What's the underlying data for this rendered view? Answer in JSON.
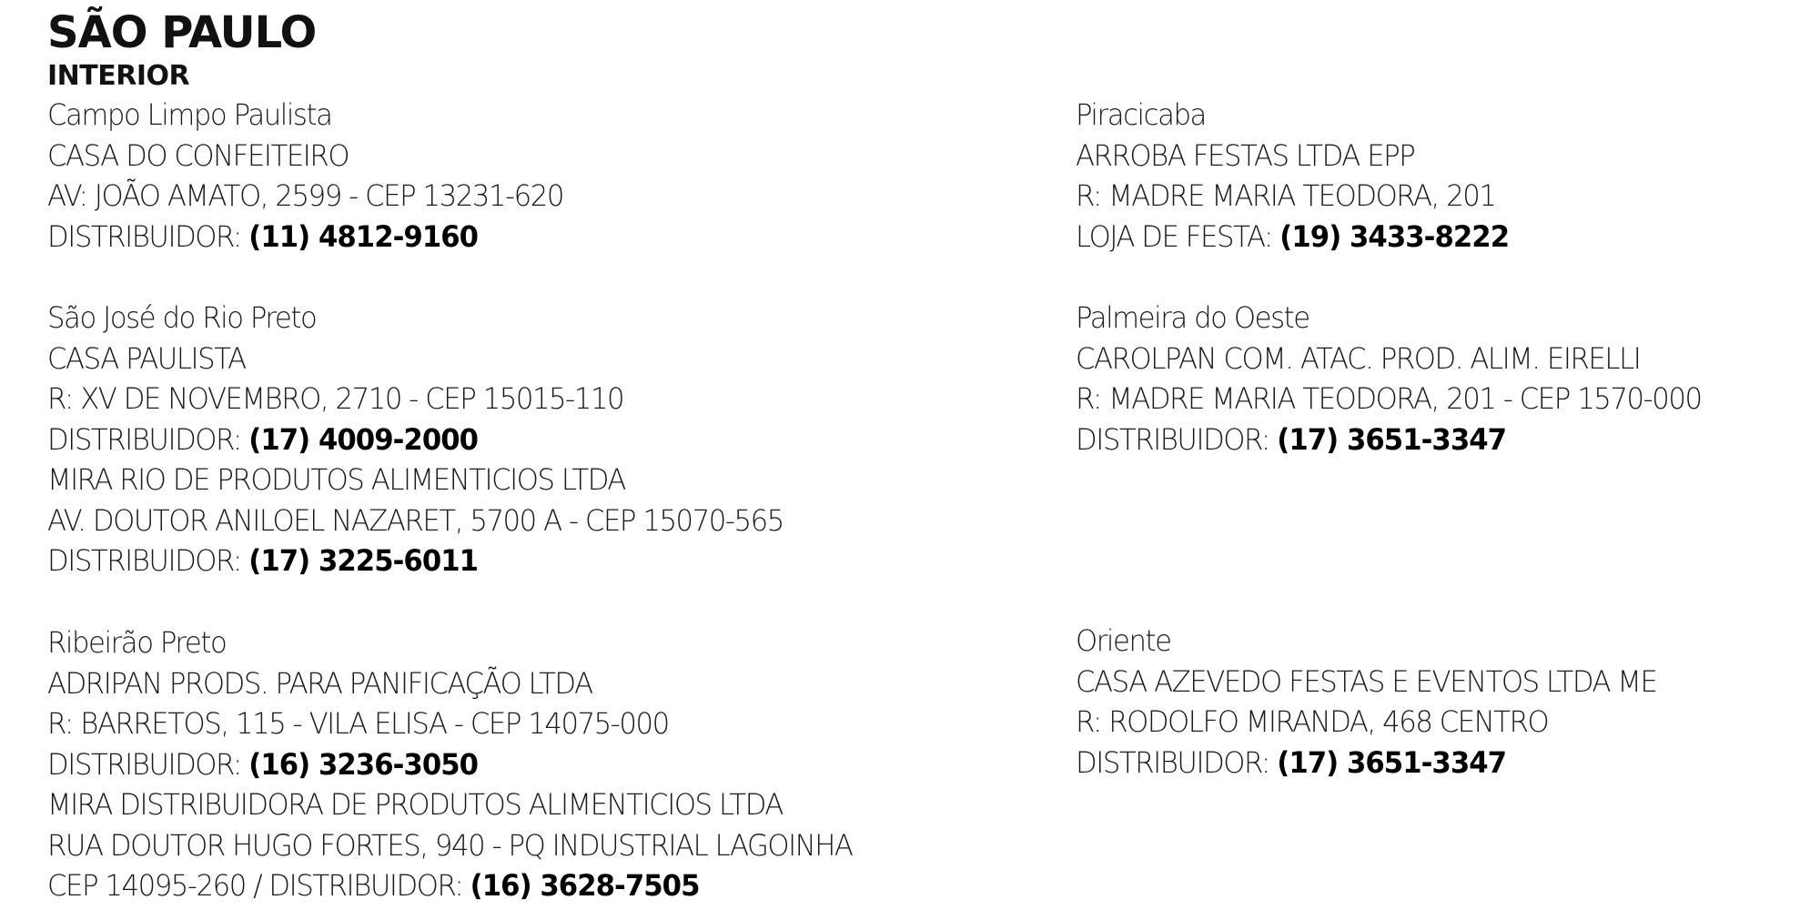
{
  "header": {
    "title": "SÃO PAULO",
    "subtitle": "INTERIOR"
  },
  "left_column": [
    {
      "city": "Campo Limpo Paulista",
      "lines": [
        {
          "text": "CASA DO CONFEITEIRO",
          "phone": ""
        },
        {
          "text": "AV: JOÃO AMATO, 2599 - CEP 13231-620",
          "phone": ""
        },
        {
          "text": "DISTRIBUIDOR: ",
          "phone": "(11) 4812-9160"
        }
      ]
    },
    {
      "city": "São José do Rio Preto",
      "lines": [
        {
          "text": "CASA PAULISTA",
          "phone": ""
        },
        {
          "text": "R: XV DE NOVEMBRO, 2710 - CEP 15015-110",
          "phone": ""
        },
        {
          "text": "DISTRIBUIDOR: ",
          "phone": "(17) 4009-2000"
        },
        {
          "text": "MIRA RIO DE PRODUTOS ALIMENTICIOS LTDA",
          "phone": ""
        },
        {
          "text": "AV. DOUTOR ANILOEL NAZARET, 5700 A - CEP 15070-565",
          "phone": ""
        },
        {
          "text": "DISTRIBUIDOR: ",
          "phone": "(17) 3225-6011"
        }
      ]
    },
    {
      "city": "Ribeirão Preto",
      "lines": [
        {
          "text": "ADRIPAN PRODS. PARA PANIFICAÇÃO LTDA",
          "phone": ""
        },
        {
          "text": "R: BARRETOS, 115 - VILA ELISA - CEP 14075-000",
          "phone": ""
        },
        {
          "text": "DISTRIBUIDOR: ",
          "phone": "(16) 3236-3050"
        },
        {
          "text": "MIRA DISTRIBUIDORA DE PRODUTOS ALIMENTICIOS LTDA",
          "phone": ""
        },
        {
          "text": "RUA DOUTOR HUGO FORTES, 940 - PQ INDUSTRIAL LAGOINHA",
          "phone": ""
        },
        {
          "text": "CEP 14095-260 / DISTRIBUIDOR: ",
          "phone": "(16) 3628-7505"
        }
      ]
    }
  ],
  "right_column": [
    {
      "city": "Piracicaba",
      "lines": [
        {
          "text": "ARROBA FESTAS LTDA EPP",
          "phone": ""
        },
        {
          "text": "R: MADRE MARIA TEODORA, 201",
          "phone": ""
        },
        {
          "text": "LOJA DE FESTA: ",
          "phone": "(19) 3433-8222"
        }
      ]
    },
    {
      "city": "Palmeira do Oeste",
      "lines": [
        {
          "text": "CAROLPAN COM. ATAC. PROD. ALIM. EIRELLI",
          "phone": ""
        },
        {
          "text": "R: MADRE MARIA TEODORA, 201 - CEP 1570-000",
          "phone": ""
        },
        {
          "text": "DISTRIBUIDOR: ",
          "phone": "(17) 3651-3347"
        }
      ]
    },
    {
      "city": "Oriente",
      "lines": [
        {
          "text": "CASA AZEVEDO FESTAS E EVENTOS LTDA ME",
          "phone": ""
        },
        {
          "text": "R: RODOLFO MIRANDA, 468 CENTRO",
          "phone": ""
        },
        {
          "text": "DISTRIBUIDOR: ",
          "phone": "(17) 3651-3347"
        }
      ]
    }
  ]
}
